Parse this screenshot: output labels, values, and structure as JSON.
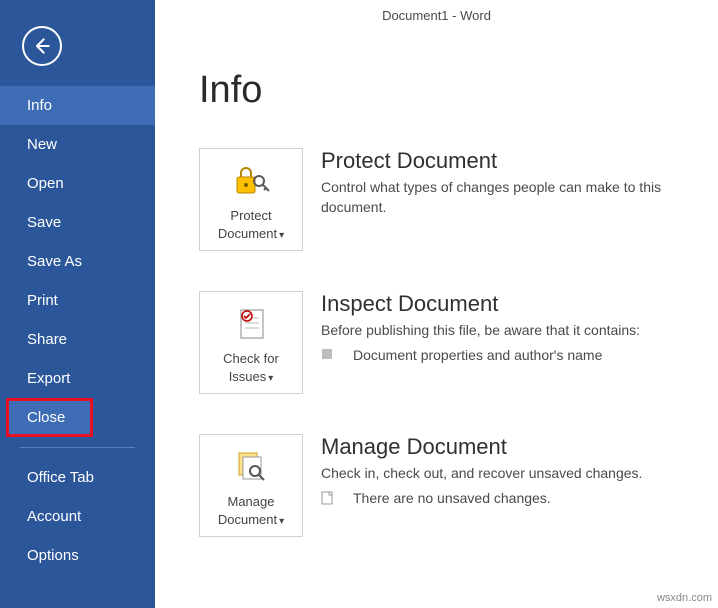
{
  "window_title": "Document1 - Word",
  "sidebar": {
    "items": [
      {
        "label": "Info"
      },
      {
        "label": "New"
      },
      {
        "label": "Open"
      },
      {
        "label": "Save"
      },
      {
        "label": "Save As"
      },
      {
        "label": "Print"
      },
      {
        "label": "Share"
      },
      {
        "label": "Export"
      },
      {
        "label": "Close"
      },
      {
        "label": "Office Tab"
      },
      {
        "label": "Account"
      },
      {
        "label": "Options"
      }
    ]
  },
  "page": {
    "heading": "Info",
    "protect": {
      "button_line1": "Protect",
      "button_line2": "Document",
      "title": "Protect Document",
      "desc": "Control what types of changes people can make to this document."
    },
    "inspect": {
      "button_line1": "Check for",
      "button_line2": "Issues",
      "title": "Inspect Document",
      "desc": "Before publishing this file, be aware that it contains:",
      "bullet": "Document properties and author's name"
    },
    "manage": {
      "button_line1": "Manage",
      "button_line2": "Document",
      "title": "Manage Document",
      "desc": "Check in, check out, and recover unsaved changes.",
      "bullet": "There are no unsaved changes."
    }
  },
  "watermark": "wsxdn.com"
}
